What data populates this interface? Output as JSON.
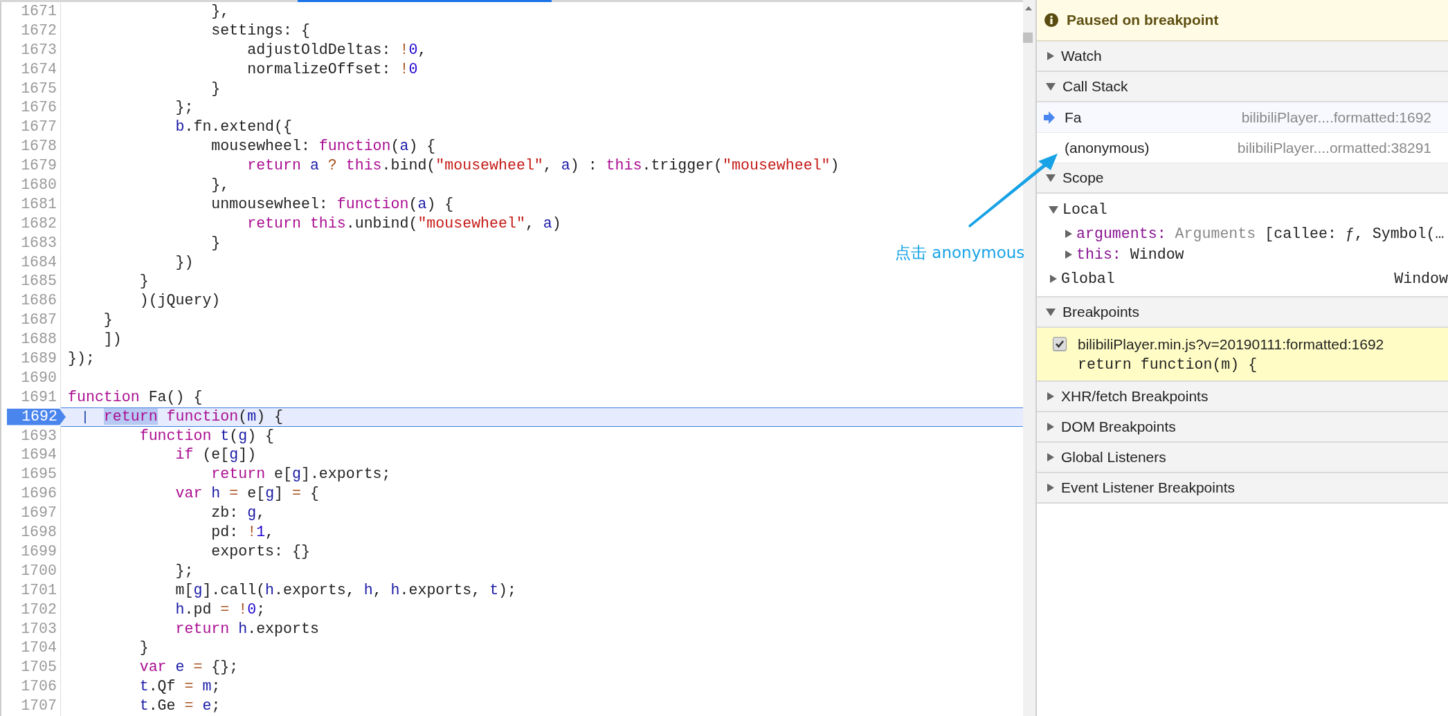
{
  "editor": {
    "lines": [
      {
        "number": "1671",
        "breakpoint": false,
        "tokens": [
          {
            "t": "                },",
            "kind": "plain"
          }
        ]
      },
      {
        "number": "1672",
        "breakpoint": false,
        "tokens": [
          {
            "t": "                settings: {",
            "kind": "plain"
          }
        ]
      },
      {
        "number": "1673",
        "breakpoint": false,
        "tokens": [
          {
            "t": "                    adjustOldDeltas: ",
            "kind": "plain"
          },
          {
            "t": "!",
            "kind": "operator"
          },
          {
            "t": "0",
            "kind": "number"
          },
          {
            "t": ",",
            "kind": "plain"
          }
        ]
      },
      {
        "number": "1674",
        "breakpoint": false,
        "tokens": [
          {
            "t": "                    normalizeOffset: ",
            "kind": "plain"
          },
          {
            "t": "!",
            "kind": "operator"
          },
          {
            "t": "0",
            "kind": "number"
          }
        ]
      },
      {
        "number": "1675",
        "breakpoint": false,
        "tokens": [
          {
            "t": "                }",
            "kind": "plain"
          }
        ]
      },
      {
        "number": "1676",
        "breakpoint": false,
        "tokens": [
          {
            "t": "            };",
            "kind": "plain"
          }
        ]
      },
      {
        "number": "1677",
        "breakpoint": false,
        "tokens": [
          {
            "t": "            b",
            "kind": "variable"
          },
          {
            "t": ".fn.extend({",
            "kind": "plain"
          }
        ]
      },
      {
        "number": "1678",
        "breakpoint": false,
        "tokens": [
          {
            "t": "                mousewheel: ",
            "kind": "plain"
          },
          {
            "t": "function",
            "kind": "keyword"
          },
          {
            "t": "(",
            "kind": "plain"
          },
          {
            "t": "a",
            "kind": "variable"
          },
          {
            "t": ") {",
            "kind": "plain"
          }
        ]
      },
      {
        "number": "1679",
        "breakpoint": false,
        "tokens": [
          {
            "t": "                    return",
            "kind": "keyword"
          },
          {
            "t": " a",
            "kind": "variable"
          },
          {
            "t": " ?",
            "kind": "operator"
          },
          {
            "t": " this",
            "kind": "keyword"
          },
          {
            "t": ".bind(",
            "kind": "plain"
          },
          {
            "t": "\"mousewheel\"",
            "kind": "string"
          },
          {
            "t": ", ",
            "kind": "plain"
          },
          {
            "t": "a",
            "kind": "variable"
          },
          {
            "t": ") : ",
            "kind": "plain"
          },
          {
            "t": "this",
            "kind": "keyword"
          },
          {
            "t": ".trigger(",
            "kind": "plain"
          },
          {
            "t": "\"mousewheel\"",
            "kind": "string"
          },
          {
            "t": ")",
            "kind": "plain"
          }
        ]
      },
      {
        "number": "1680",
        "breakpoint": false,
        "tokens": [
          {
            "t": "                },",
            "kind": "plain"
          }
        ]
      },
      {
        "number": "1681",
        "breakpoint": false,
        "tokens": [
          {
            "t": "                unmousewheel: ",
            "kind": "plain"
          },
          {
            "t": "function",
            "kind": "keyword"
          },
          {
            "t": "(",
            "kind": "plain"
          },
          {
            "t": "a",
            "kind": "variable"
          },
          {
            "t": ") {",
            "kind": "plain"
          }
        ]
      },
      {
        "number": "1682",
        "breakpoint": false,
        "tokens": [
          {
            "t": "                    return",
            "kind": "keyword"
          },
          {
            "t": " this",
            "kind": "keyword"
          },
          {
            "t": ".unbind(",
            "kind": "plain"
          },
          {
            "t": "\"mousewheel\"",
            "kind": "string"
          },
          {
            "t": ", ",
            "kind": "plain"
          },
          {
            "t": "a",
            "kind": "variable"
          },
          {
            "t": ")",
            "kind": "plain"
          }
        ]
      },
      {
        "number": "1683",
        "breakpoint": false,
        "tokens": [
          {
            "t": "                }",
            "kind": "plain"
          }
        ]
      },
      {
        "number": "1684",
        "breakpoint": false,
        "tokens": [
          {
            "t": "            })",
            "kind": "plain"
          }
        ]
      },
      {
        "number": "1685",
        "breakpoint": false,
        "tokens": [
          {
            "t": "        }",
            "kind": "plain"
          }
        ]
      },
      {
        "number": "1686",
        "breakpoint": false,
        "tokens": [
          {
            "t": "        )(jQuery)",
            "kind": "plain"
          }
        ]
      },
      {
        "number": "1687",
        "breakpoint": false,
        "tokens": [
          {
            "t": "    }",
            "kind": "plain"
          }
        ]
      },
      {
        "number": "1688",
        "breakpoint": false,
        "tokens": [
          {
            "t": "    ])",
            "kind": "plain"
          }
        ]
      },
      {
        "number": "1689",
        "breakpoint": false,
        "tokens": [
          {
            "t": "});",
            "kind": "plain"
          }
        ]
      },
      {
        "number": "1690",
        "breakpoint": false
      },
      {
        "number": "1691",
        "breakpoint": false,
        "tokens": [
          {
            "t": "function",
            "kind": "keyword"
          },
          {
            "t": " Fa() {",
            "kind": "plain"
          }
        ]
      },
      {
        "number": "1692",
        "breakpoint": true,
        "tokens": [
          {
            "t": "    return",
            "kind": "cursor"
          },
          {
            "t": " function",
            "kind": "keyword"
          },
          {
            "t": "(",
            "kind": "plain"
          },
          {
            "t": "m",
            "kind": "variable"
          },
          {
            "t": ") {",
            "kind": "plain"
          }
        ]
      },
      {
        "number": "1693",
        "breakpoint": false,
        "tokens": [
          {
            "t": "        function",
            "kind": "keyword"
          },
          {
            "t": " t",
            "kind": "variable"
          },
          {
            "t": "(",
            "kind": "plain"
          },
          {
            "t": "g",
            "kind": "variable"
          },
          {
            "t": ") {",
            "kind": "plain"
          }
        ]
      },
      {
        "number": "1694",
        "breakpoint": false,
        "tokens": [
          {
            "t": "            if",
            "kind": "keyword"
          },
          {
            "t": " (e[",
            "kind": "plain"
          },
          {
            "t": "g",
            "kind": "variable"
          },
          {
            "t": "])",
            "kind": "plain"
          }
        ]
      },
      {
        "number": "1695",
        "breakpoint": false,
        "tokens": [
          {
            "t": "                return",
            "kind": "keyword"
          },
          {
            "t": " e[",
            "kind": "plain"
          },
          {
            "t": "g",
            "kind": "variable"
          },
          {
            "t": "].exports;",
            "kind": "plain"
          }
        ]
      },
      {
        "number": "1696",
        "breakpoint": false,
        "tokens": [
          {
            "t": "            var",
            "kind": "keyword"
          },
          {
            "t": " h",
            "kind": "variable"
          },
          {
            "t": " =",
            "kind": "operator"
          },
          {
            "t": " e[",
            "kind": "plain"
          },
          {
            "t": "g",
            "kind": "variable"
          },
          {
            "t": "]",
            "kind": "plain"
          },
          {
            "t": " =",
            "kind": "operator"
          },
          {
            "t": " {",
            "kind": "plain"
          }
        ]
      },
      {
        "number": "1697",
        "breakpoint": false,
        "tokens": [
          {
            "t": "                zb: ",
            "kind": "plain"
          },
          {
            "t": "g",
            "kind": "variable"
          },
          {
            "t": ",",
            "kind": "plain"
          }
        ]
      },
      {
        "number": "1698",
        "breakpoint": false,
        "tokens": [
          {
            "t": "                pd: ",
            "kind": "plain"
          },
          {
            "t": "!",
            "kind": "operator"
          },
          {
            "t": "1",
            "kind": "number"
          },
          {
            "t": ",",
            "kind": "plain"
          }
        ]
      },
      {
        "number": "1699",
        "breakpoint": false,
        "tokens": [
          {
            "t": "                exports: {}",
            "kind": "plain"
          }
        ]
      },
      {
        "number": "1700",
        "breakpoint": false,
        "tokens": [
          {
            "t": "            };",
            "kind": "plain"
          }
        ]
      },
      {
        "number": "1701",
        "breakpoint": false,
        "tokens": [
          {
            "t": "            m[",
            "kind": "plain"
          },
          {
            "t": "g",
            "kind": "variable"
          },
          {
            "t": "].call(",
            "kind": "plain"
          },
          {
            "t": "h",
            "kind": "variable"
          },
          {
            "t": ".exports, ",
            "kind": "plain"
          },
          {
            "t": "h",
            "kind": "variable"
          },
          {
            "t": ", ",
            "kind": "plain"
          },
          {
            "t": "h",
            "kind": "variable"
          },
          {
            "t": ".exports, ",
            "kind": "plain"
          },
          {
            "t": "t",
            "kind": "variable"
          },
          {
            "t": ");",
            "kind": "plain"
          }
        ]
      },
      {
        "number": "1702",
        "breakpoint": false,
        "tokens": [
          {
            "t": "            h",
            "kind": "variable"
          },
          {
            "t": ".pd",
            "kind": "plain"
          },
          {
            "t": " = !",
            "kind": "operator"
          },
          {
            "t": "0",
            "kind": "number"
          },
          {
            "t": ";",
            "kind": "plain"
          }
        ]
      },
      {
        "number": "1703",
        "breakpoint": false,
        "tokens": [
          {
            "t": "            return",
            "kind": "keyword"
          },
          {
            "t": " h",
            "kind": "variable"
          },
          {
            "t": ".exports",
            "kind": "plain"
          }
        ]
      },
      {
        "number": "1704",
        "breakpoint": false,
        "tokens": [
          {
            "t": "        }",
            "kind": "plain"
          }
        ]
      },
      {
        "number": "1705",
        "breakpoint": false,
        "tokens": [
          {
            "t": "        var",
            "kind": "keyword"
          },
          {
            "t": " e",
            "kind": "variable"
          },
          {
            "t": " =",
            "kind": "operator"
          },
          {
            "t": " {};",
            "kind": "plain"
          }
        ]
      },
      {
        "number": "1706",
        "breakpoint": false,
        "tokens": [
          {
            "t": "        t",
            "kind": "variable"
          },
          {
            "t": ".Qf",
            "kind": "plain"
          },
          {
            "t": " =",
            "kind": "operator"
          },
          {
            "t": " m",
            "kind": "variable"
          },
          {
            "t": ";",
            "kind": "plain"
          }
        ]
      },
      {
        "number": "1707",
        "breakpoint": false,
        "tokens": [
          {
            "t": "        t",
            "kind": "variable"
          },
          {
            "t": ".Ge",
            "kind": "plain"
          },
          {
            "t": " =",
            "kind": "operator"
          },
          {
            "t": " e",
            "kind": "variable"
          },
          {
            "t": ";",
            "kind": "plain"
          }
        ]
      }
    ]
  },
  "debugger_sidebar": {
    "banner": {
      "text": "Paused on breakpoint"
    },
    "sections": [
      {
        "kind": "plain",
        "title": "Watch",
        "expanded": false
      },
      {
        "kind": "callstack",
        "title": "Call Stack",
        "expanded": true,
        "frames": [
          {
            "name": "Fa",
            "location": "bilibiliPlayer....formatted:1692",
            "selected": true
          },
          {
            "name": "(anonymous)",
            "location": "bilibiliPlayer....ormatted:38291",
            "selected": false
          }
        ]
      },
      {
        "kind": "scope",
        "title": "Scope",
        "expanded": true,
        "scopes": [
          {
            "name": "Local",
            "expanded": true,
            "children": [
              {
                "name": "arguments:",
                "type": "Arguments",
                "value": "[callee: ƒ, Symbol(…",
                "expanded": false
              },
              {
                "name": "this:",
                "value": "Window",
                "expanded": false
              }
            ]
          },
          {
            "name": "Global",
            "value": "Window",
            "expanded": false
          }
        ]
      },
      {
        "kind": "breakpoints",
        "title": "Breakpoints",
        "expanded": true,
        "items": [
          {
            "location": "bilibiliPlayer.min.js?v=20190111:formatted:1692",
            "code": "return function(m) {",
            "checked": true,
            "hit": true
          }
        ]
      },
      {
        "kind": "plain",
        "title": "XHR/fetch Breakpoints",
        "expanded": false
      },
      {
        "kind": "plain",
        "title": "DOM Breakpoints",
        "expanded": false
      },
      {
        "kind": "plain",
        "title": "Global Listeners",
        "expanded": false
      },
      {
        "kind": "plain",
        "title": "Event Listener Breakpoints",
        "expanded": false
      }
    ]
  },
  "annotation": {
    "text": "点击 anonymous"
  }
}
